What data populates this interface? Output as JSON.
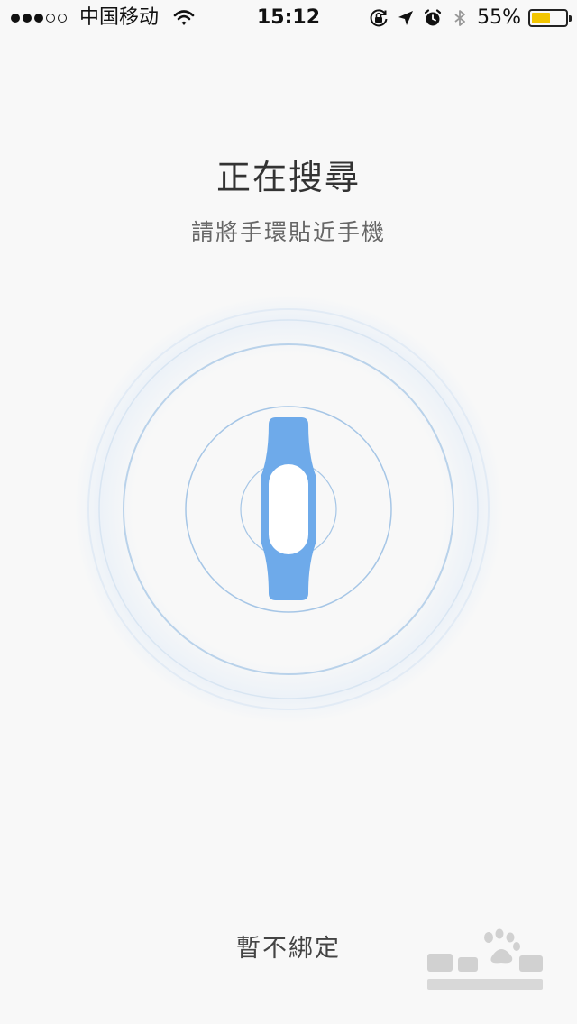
{
  "status_bar": {
    "signal_strength": 3,
    "signal_max": 5,
    "carrier": "中国移动",
    "time": "15:12",
    "battery_percent_label": "55%",
    "battery_level": 0.55,
    "battery_color": "#f2c500",
    "icons": [
      "wifi-icon",
      "orientation-lock-icon",
      "location-arrow-icon",
      "alarm-icon",
      "bluetooth-icon"
    ]
  },
  "main": {
    "title": "正在搜尋",
    "subtitle": "請將手環貼近手機",
    "device_icon": "band-icon",
    "accent_color": "#6eaaea"
  },
  "footer": {
    "skip_label": "暫不綁定"
  },
  "watermark": {
    "brand": "Baidu",
    "brand_cn": "经验",
    "url": "jingyan.baidu.com"
  }
}
